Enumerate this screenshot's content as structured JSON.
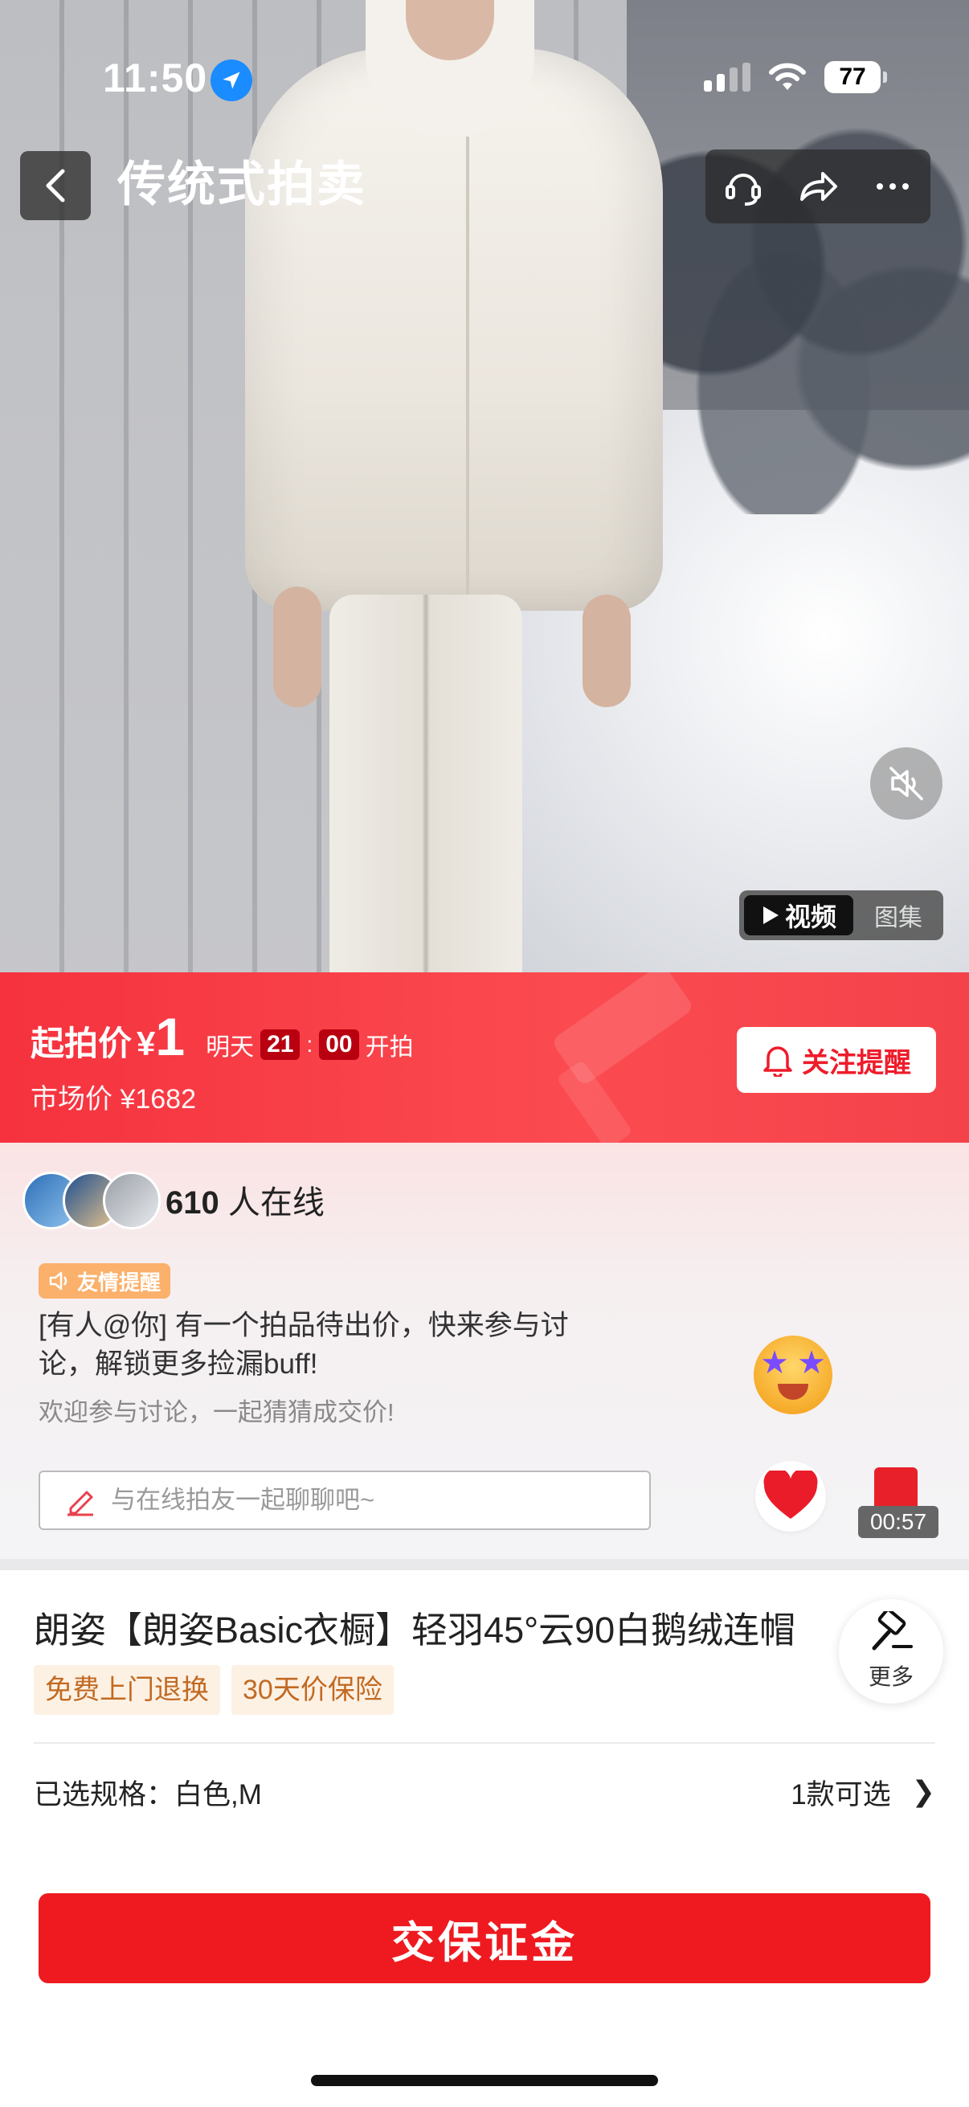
{
  "status_bar": {
    "time": "11:50",
    "battery": "77"
  },
  "nav": {
    "title": "传统式拍卖"
  },
  "media": {
    "video_label": "视频",
    "gallery_label": "图集"
  },
  "auction": {
    "start_price_label": "起拍价",
    "currency": "¥",
    "start_price": "1",
    "start_day": "明天",
    "start_hour": "21",
    "start_colon": ":",
    "start_minute": "00",
    "start_suffix": "开拍",
    "market_price": "市场价 ¥1682",
    "follow_label": "关注提醒"
  },
  "live": {
    "online_count": "610",
    "online_suffix": "人在线",
    "tip_badge": "友情提醒",
    "tip_text": "[有人@你] 有一个拍品待出价，快来参与讨论，解锁更多捡漏buff!",
    "tip_sub": "欢迎参与讨论，一起猜猜成交价!",
    "chat_placeholder": "与在线拍友一起聊聊吧~",
    "gift_timer": "00:57"
  },
  "product": {
    "title": "朗姿【朗姿Basic衣橱】轻羽45°云90白鹅绒连帽",
    "tags": [
      "免费上门退换",
      "30天价保险"
    ],
    "more_label": "更多",
    "spec_label": "已选规格：白色,M",
    "spec_options": "1款可选",
    "spec_chevron": "❯"
  },
  "cta": {
    "label": "交保证金"
  },
  "colors": {
    "primary_red": "#ee1a20",
    "tag_bg": "#fdf1e4",
    "tag_text": "#c26a22"
  }
}
